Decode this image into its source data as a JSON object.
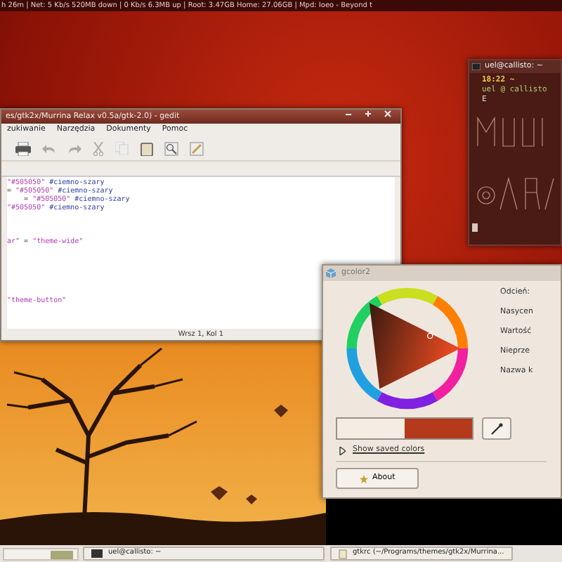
{
  "status_bar": {
    "text": "h 26m  |  Net: 5 Kb/s  520MB down  |  0 Kb/s  6.3MB up  |  Root: 3.47GB  Home: 27.06GB  |   Mpd: Ioeo - Beyond t"
  },
  "terminal": {
    "title": "uel@callisto: ~",
    "lines": [
      {
        "kind": "clock",
        "text": "18:22  ~"
      },
      {
        "kind": "prompt",
        "text": "uel @ callisto"
      },
      {
        "kind": "plain",
        "text": "E"
      }
    ]
  },
  "gedit": {
    "title": "es/gtk2x/Murrina Relax v0.5a/gtk-2.0) - gedit",
    "menu": [
      "zukiwanie",
      "Narzędzia",
      "Dokumenty",
      "Pomoc"
    ],
    "code_blocks": [
      [
        [
          {
            "kind": "string",
            "text": "\"#505050\""
          },
          {
            "kind": "comment",
            "text": " #ciemno-szary"
          }
        ],
        [
          {
            "kind": "op",
            "text": "= "
          },
          {
            "kind": "string",
            "text": "\"#505050\""
          },
          {
            "kind": "comment",
            "text": " #ciemno-szary"
          }
        ],
        [
          {
            "kind": "op",
            "text": "    = "
          },
          {
            "kind": "string",
            "text": "\"#505050\""
          },
          {
            "kind": "comment",
            "text": " #ciemno-szary"
          }
        ],
        [
          {
            "kind": "string",
            "text": "\"#505050\""
          },
          {
            "kind": "comment",
            "text": " #ciemno-szary"
          }
        ]
      ],
      [
        [
          {
            "kind": "string",
            "text": "ar\""
          },
          {
            "kind": "op",
            "text": " = "
          },
          {
            "kind": "string",
            "text": "\"theme-wide\""
          }
        ]
      ],
      [
        [
          {
            "kind": "string",
            "text": "\"theme-button\""
          }
        ]
      ]
    ],
    "status": "Wrsz 1, Kol 1"
  },
  "gcolor2": {
    "title": "gcolor2",
    "labels": [
      "Odcień:",
      "Nasycen",
      "Wartość",
      "Nieprze",
      "Nazwa k"
    ],
    "swatches": [
      {
        "color": "#f5ece3"
      },
      {
        "color": "#b5391b"
      }
    ],
    "expander": {
      "label": "Show saved colors",
      "expanded": false
    },
    "about": "About"
  },
  "taskbar": {
    "tasks": [
      {
        "label": "uel@callisto: ~",
        "selected": false
      },
      {
        "label": "gtkrc (~/Programs/themes/gtk2x/Murrina...",
        "selected": false
      }
    ]
  }
}
